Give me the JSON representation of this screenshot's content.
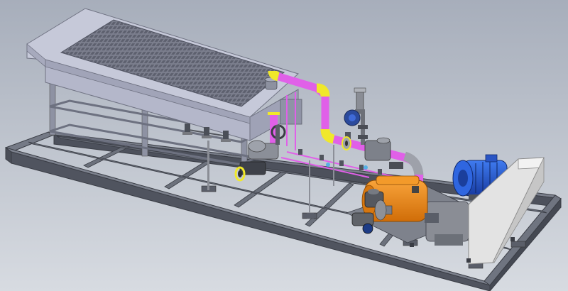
{
  "viewport": {
    "background_top": "#a7aebb",
    "background_bottom": "#d7dbe1"
  },
  "colors": {
    "frame": "#5f6370",
    "frame_dark": "#3f434d",
    "frame_light": "#858a96",
    "tank": "#b7bacd",
    "tank_dark": "#9b9eb2",
    "tank_top": "#c5c8d8",
    "grille": "#6b6e7d",
    "pipe_magenta": "#e05ae6",
    "pipe_yellow": "#f2ea2a",
    "pump_orange": "#f08a14",
    "motor_blue": "#1f58d8",
    "motor_dark": "#16379a",
    "enclosure": "#e4e4e4",
    "enclosure_shade": "#c9c9c9",
    "valve_gray": "#8a8d95"
  },
  "icons": {
    "isolation_valve": "valve-icon",
    "flange": "flange-icon",
    "relief_valve": "relief-valve-icon",
    "handwheel": "handwheel-icon"
  }
}
